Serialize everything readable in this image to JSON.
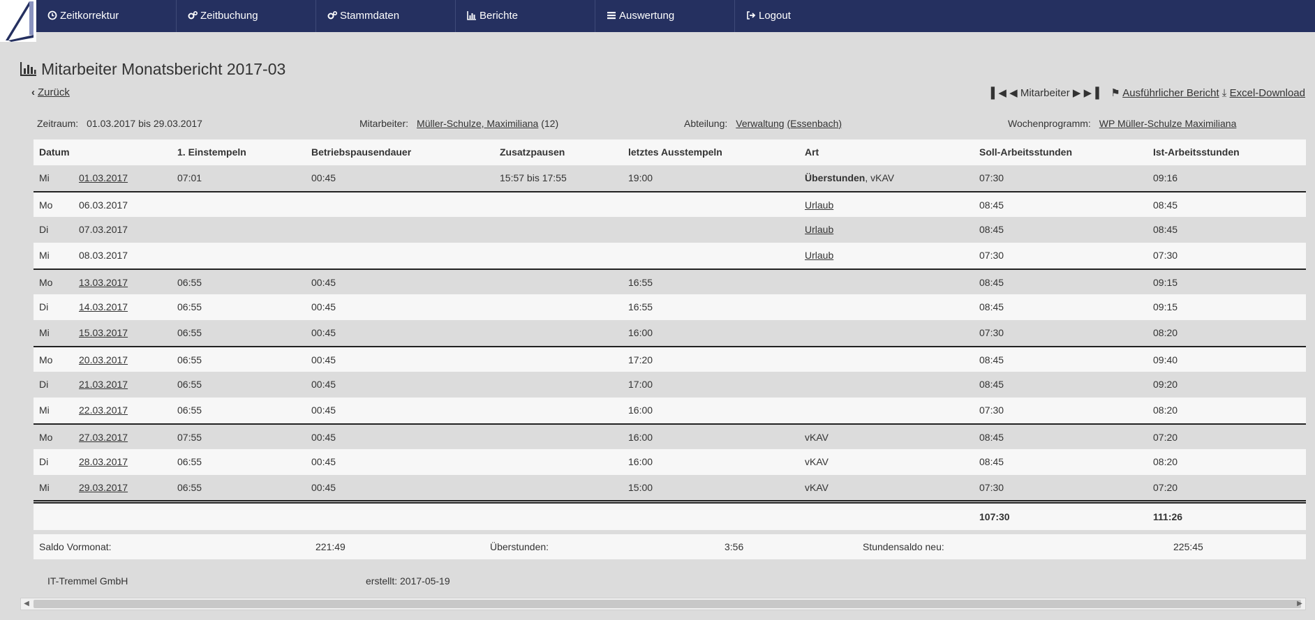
{
  "nav": {
    "items": [
      {
        "label": "Zeitkorrektur",
        "icon": "clock-icon"
      },
      {
        "label": "Zeitbuchung",
        "icon": "gears-icon"
      },
      {
        "label": "Stammdaten",
        "icon": "gears-icon"
      },
      {
        "label": "Berichte",
        "icon": "bar-chart-icon"
      },
      {
        "label": "Auswertung",
        "icon": "list-icon"
      },
      {
        "label": "Logout",
        "icon": "logout-icon"
      }
    ]
  },
  "header": {
    "title": "Mitarbeiter Monatsbericht 2017-03",
    "back_label": "Zurück",
    "employee_nav_label": "Mitarbeiter",
    "detail_report_label": "Ausführlicher Bericht",
    "excel_label": "Excel-Download"
  },
  "info": {
    "zeitraum_label": "Zeitraum:",
    "zeitraum_value": "01.03.2017 bis 29.03.2017",
    "mitarbeiter_label": "Mitarbeiter:",
    "mitarbeiter_value": "Müller-Schulze, Maximiliana",
    "mitarbeiter_id": "(12)",
    "abteilung_label": "Abteilung:",
    "abteilung_value": "Verwaltung",
    "abteilung_place": "(Essenbach)",
    "wochenprogramm_label": "Wochenprogramm:",
    "wochenprogramm_value": "WP Müller-Schulze Maximiliana"
  },
  "table": {
    "headers": [
      "Datum",
      "1. Einstempeln",
      "Betriebspausendauer",
      "Zusatzpausen",
      "letztes Ausstempeln",
      "Art",
      "Soll-Arbeitsstunden",
      "Ist-Arbeitsstunden"
    ],
    "rows": [
      {
        "day": "Mi",
        "date": "01.03.2017",
        "in": "07:01",
        "pause": "00:45",
        "extra": "15:57 bis 17:55",
        "out": "19:00",
        "art_bold": "Überstunden",
        "art": ", vKAV",
        "soll": "07:30",
        "ist": "09:16"
      },
      {
        "day": "Mo",
        "date": "06.03.2017",
        "in": "",
        "pause": "",
        "extra": "",
        "out": "",
        "art_bold": "",
        "art": "Urlaub",
        "soll": "08:45",
        "ist": "08:45"
      },
      {
        "day": "Di",
        "date": "07.03.2017",
        "in": "",
        "pause": "",
        "extra": "",
        "out": "",
        "art_bold": "",
        "art": "Urlaub",
        "soll": "08:45",
        "ist": "08:45"
      },
      {
        "day": "Mi",
        "date": "08.03.2017",
        "in": "",
        "pause": "",
        "extra": "",
        "out": "",
        "art_bold": "",
        "art": "Urlaub",
        "soll": "07:30",
        "ist": "07:30"
      },
      {
        "day": "Mo",
        "date": "13.03.2017",
        "in": "06:55",
        "pause": "00:45",
        "extra": "",
        "out": "16:55",
        "art_bold": "",
        "art": "",
        "soll": "08:45",
        "ist": "09:15"
      },
      {
        "day": "Di",
        "date": "14.03.2017",
        "in": "06:55",
        "pause": "00:45",
        "extra": "",
        "out": "16:55",
        "art_bold": "",
        "art": "",
        "soll": "08:45",
        "ist": "09:15"
      },
      {
        "day": "Mi",
        "date": "15.03.2017",
        "in": "06:55",
        "pause": "00:45",
        "extra": "",
        "out": "16:00",
        "art_bold": "",
        "art": "",
        "soll": "07:30",
        "ist": "08:20"
      },
      {
        "day": "Mo",
        "date": "20.03.2017",
        "in": "06:55",
        "pause": "00:45",
        "extra": "",
        "out": "17:20",
        "art_bold": "",
        "art": "",
        "soll": "08:45",
        "ist": "09:40"
      },
      {
        "day": "Di",
        "date": "21.03.2017",
        "in": "06:55",
        "pause": "00:45",
        "extra": "",
        "out": "17:00",
        "art_bold": "",
        "art": "",
        "soll": "08:45",
        "ist": "09:20"
      },
      {
        "day": "Mi",
        "date": "22.03.2017",
        "in": "06:55",
        "pause": "00:45",
        "extra": "",
        "out": "16:00",
        "art_bold": "",
        "art": "",
        "soll": "07:30",
        "ist": "08:20"
      },
      {
        "day": "Mo",
        "date": "27.03.2017",
        "in": "07:55",
        "pause": "00:45",
        "extra": "",
        "out": "16:00",
        "art_bold": "",
        "art": "vKAV",
        "soll": "08:45",
        "ist": "07:20"
      },
      {
        "day": "Di",
        "date": "28.03.2017",
        "in": "06:55",
        "pause": "00:45",
        "extra": "",
        "out": "16:00",
        "art_bold": "",
        "art": "vKAV",
        "soll": "08:45",
        "ist": "08:20"
      },
      {
        "day": "Mi",
        "date": "29.03.2017",
        "in": "06:55",
        "pause": "00:45",
        "extra": "",
        "out": "15:00",
        "art_bold": "",
        "art": "vKAV",
        "soll": "07:30",
        "ist": "07:20"
      }
    ],
    "total_soll": "107:30",
    "total_ist": "111:26"
  },
  "saldo": {
    "vormonat_label": "Saldo Vormonat:",
    "vormonat_value": "221:49",
    "ueberstunden_label": "Überstunden:",
    "ueberstunden_value": "3:56",
    "neu_label": "Stundensaldo neu:",
    "neu_value": "225:45"
  },
  "footer": {
    "company": "IT-Tremmel GmbH",
    "created": "erstellt: 2017-05-19"
  },
  "colors": {
    "navbar": "#253060",
    "background": "#dcdcdc",
    "row_light": "#f7f7f7"
  }
}
